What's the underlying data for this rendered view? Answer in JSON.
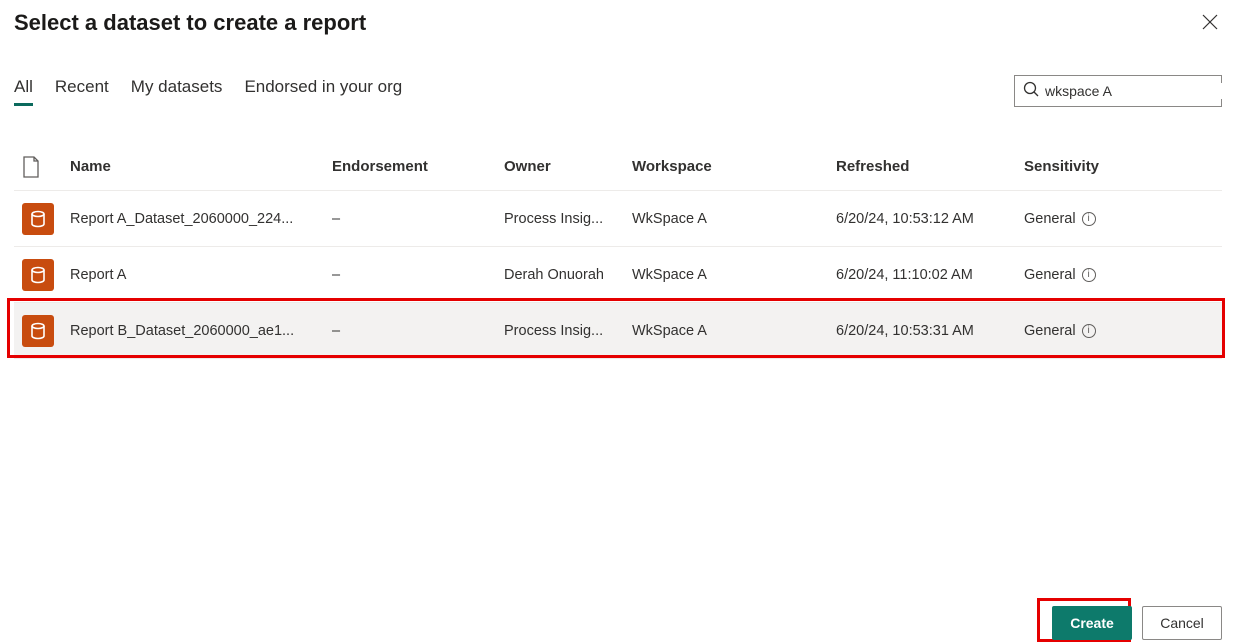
{
  "dialog": {
    "title": "Select a dataset to create a report"
  },
  "tabs": {
    "all": "All",
    "recent": "Recent",
    "my_datasets": "My datasets",
    "endorsed": "Endorsed in your org"
  },
  "search": {
    "value": "wkspace A"
  },
  "columns": {
    "name": "Name",
    "endorsement": "Endorsement",
    "owner": "Owner",
    "workspace": "Workspace",
    "refreshed": "Refreshed",
    "sensitivity": "Sensitivity"
  },
  "rows": [
    {
      "name": "Report A_Dataset_2060000_224...",
      "endorsement": "–",
      "owner": "Process Insig...",
      "workspace": "WkSpace A",
      "refreshed": "6/20/24, 10:53:12 AM",
      "sensitivity": "General"
    },
    {
      "name": "Report A",
      "endorsement": "–",
      "owner": "Derah Onuorah",
      "workspace": "WkSpace A",
      "refreshed": "6/20/24, 11:10:02 AM",
      "sensitivity": "General"
    },
    {
      "name": "Report B_Dataset_2060000_ae1...",
      "endorsement": "–",
      "owner": "Process Insig...",
      "workspace": "WkSpace A",
      "refreshed": "6/20/24, 10:53:31 AM",
      "sensitivity": "General"
    }
  ],
  "footer": {
    "create": "Create",
    "cancel": "Cancel"
  }
}
